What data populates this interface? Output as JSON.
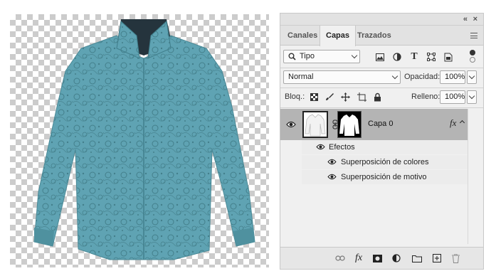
{
  "panel": {
    "collapse_glyph": "«",
    "close_glyph": "×",
    "tabs": [
      {
        "label": "Canales",
        "active": false
      },
      {
        "label": "Capas",
        "active": true
      },
      {
        "label": "Trazados",
        "active": false
      }
    ]
  },
  "filter": {
    "kind_label": "Tipo",
    "icons": [
      "image-filter-icon",
      "adjustment-filter-icon",
      "type-filter-icon",
      "shape-filter-icon",
      "smart-object-filter-icon"
    ]
  },
  "blend": {
    "mode": "Normal",
    "opacity_label": "Opacidad:",
    "opacity_value": "100%"
  },
  "lock": {
    "label": "Bloq.:",
    "fill_label": "Relleno:",
    "fill_value": "100%"
  },
  "layers": [
    {
      "name": "Capa 0",
      "visible": true,
      "fx_label": "fx",
      "effects_label": "Efectos",
      "effects": [
        "Superposición de colores",
        "Superposición de motivo"
      ]
    }
  ],
  "bottom_icons": [
    "link-icon",
    "fx-icon",
    "mask-icon",
    "adjustment-icon",
    "folder-icon",
    "new-layer-icon",
    "trash-icon"
  ],
  "colors": {
    "shirt": "#5fa3b3",
    "shirt_dark": "#3f7d8a",
    "selected_row": "#b4b4b4"
  }
}
